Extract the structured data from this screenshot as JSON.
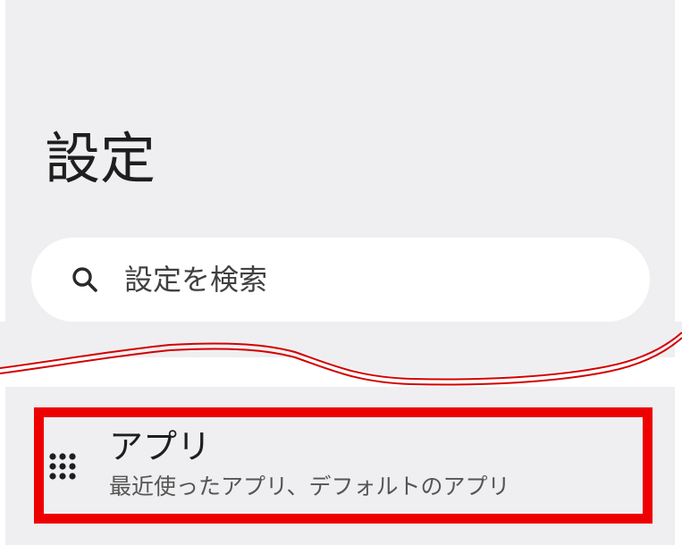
{
  "header": {
    "title": "設定"
  },
  "search": {
    "placeholder": "設定を検索",
    "icon": "search-icon"
  },
  "list": {
    "items": [
      {
        "title": "アプリ",
        "subtitle": "最近使ったアプリ、デフォルトのアプリ",
        "icon": "apps-grid-icon",
        "highlighted": true
      }
    ]
  },
  "colors": {
    "background": "#efeff1",
    "search_bg": "#ffffff",
    "text_primary": "#1e1e1e",
    "text_secondary": "#555555",
    "highlight": "#ee0000"
  }
}
